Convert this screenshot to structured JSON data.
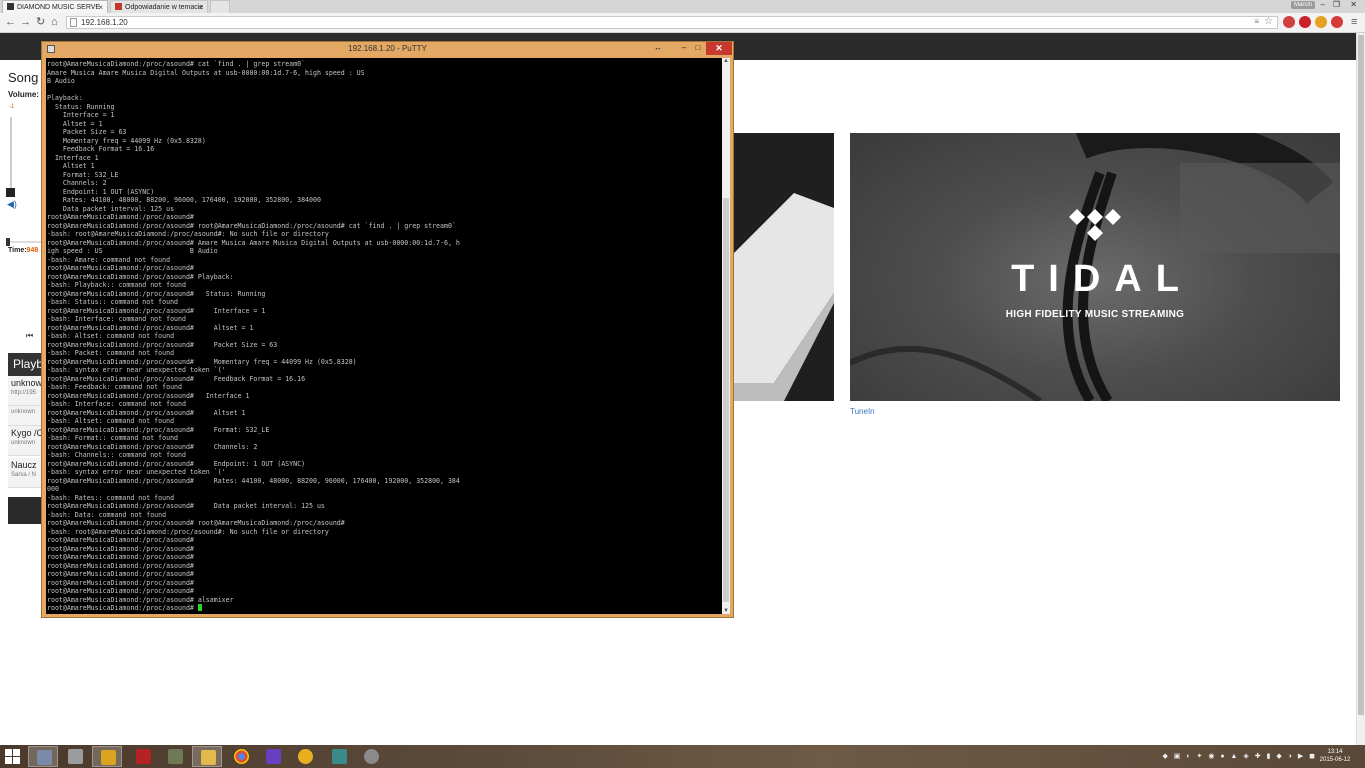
{
  "browser": {
    "tabs": [
      {
        "label": "DIAMOND MUSIC SERVE",
        "active": true
      },
      {
        "label": "Odpowiadanie w temacie",
        "active": false
      }
    ],
    "user_badge": "Marcin",
    "url": "192.168.1.20",
    "controls": {
      "minimize": "–",
      "maximize": "❐",
      "close": "✕"
    }
  },
  "page": {
    "song_title": "Song",
    "volume_label": "Volume:",
    "volume_value": "-1",
    "time_label": "Time:",
    "time_value": "948",
    "playlist_title": "Playback",
    "playlist": [
      {
        "title": "unknown",
        "subtitle": "http://195"
      },
      {
        "title": "",
        "subtitle": "unknown"
      },
      {
        "title": "Kygo /C",
        "subtitle": "unknown"
      },
      {
        "title": "Naucz",
        "subtitle": "Sarsa / N"
      }
    ],
    "tidal_title": "TIDAL",
    "tidal_subtitle": "HIGH FIDELITY MUSIC STREAMING",
    "tunein_label": "TuneIn"
  },
  "putty": {
    "title": "192.168.1.20 - PuTTY",
    "lines": [
      "root@AmareMusicaDiamond:/proc/asound# cat `find . | grep stream0`",
      "Amare Musica Amare Musica Digital Outputs at usb-0000:00:1d.7-6, high speed : US",
      "B Audio",
      "",
      "Playback:",
      "  Status: Running",
      "    Interface = 1",
      "    Altset = 1",
      "    Packet Size = 63",
      "    Momentary freq = 44099 Hz (0x5.8328)",
      "    Feedback Format = 16.16",
      "  Interface 1",
      "    Altset 1",
      "    Format: S32_LE",
      "    Channels: 2",
      "    Endpoint: 1 OUT (ASYNC)",
      "    Rates: 44100, 48000, 88200, 96000, 176400, 192000, 352800, 384000",
      "    Data packet interval: 125 us",
      "root@AmareMusicaDiamond:/proc/asound#",
      "root@AmareMusicaDiamond:/proc/asound# root@AmareMusicaDiamond:/proc/asound# cat `find . | grep stream0`",
      "-bash: root@AmareMusicaDiamond:/proc/asound#: No such file or directory",
      "root@AmareMusicaDiamond:/proc/asound# Amare Musica Amare Musica Digital Outputs at usb-0000:00:1d.7-6, h",
      "igh speed : US                      B Audio",
      "-bash: Amare: command not found",
      "root@AmareMusicaDiamond:/proc/asound#",
      "root@AmareMusicaDiamond:/proc/asound# Playback:",
      "-bash: Playback:: command not found",
      "root@AmareMusicaDiamond:/proc/asound#   Status: Running",
      "-bash: Status:: command not found",
      "root@AmareMusicaDiamond:/proc/asound#     Interface = 1",
      "-bash: Interface: command not found",
      "root@AmareMusicaDiamond:/proc/asound#     Altset = 1",
      "-bash: Altset: command not found",
      "root@AmareMusicaDiamond:/proc/asound#     Packet Size = 63",
      "-bash: Packet: command not found",
      "root@AmareMusicaDiamond:/proc/asound#     Momentary freq = 44099 Hz (0x5.8328)",
      "-bash: syntax error near unexpected token `('",
      "root@AmareMusicaDiamond:/proc/asound#     Feedback Format = 16.16",
      "-bash: Feedback: command not found",
      "root@AmareMusicaDiamond:/proc/asound#   Interface 1",
      "-bash: Interface: command not found",
      "root@AmareMusicaDiamond:/proc/asound#     Altset 1",
      "-bash: Altset: command not found",
      "root@AmareMusicaDiamond:/proc/asound#     Format: S32_LE",
      "-bash: Format:: command not found",
      "root@AmareMusicaDiamond:/proc/asound#     Channels: 2",
      "-bash: Channels:: command not found",
      "root@AmareMusicaDiamond:/proc/asound#     Endpoint: 1 OUT (ASYNC)",
      "-bash: syntax error near unexpected token `('",
      "root@AmareMusicaDiamond:/proc/asound#     Rates: 44100, 48000, 88200, 96000, 176400, 192000, 352800, 384",
      "000",
      "-bash: Rates:: command not found",
      "root@AmareMusicaDiamond:/proc/asound#     Data packet interval: 125 us",
      "-bash: Data: command not found",
      "root@AmareMusicaDiamond:/proc/asound# root@AmareMusicaDiamond:/proc/asound#",
      "-bash: root@AmareMusicaDiamond:/proc/asound#: No such file or directory",
      "root@AmareMusicaDiamond:/proc/asound#",
      "root@AmareMusicaDiamond:/proc/asound#",
      "root@AmareMusicaDiamond:/proc/asound#",
      "root@AmareMusicaDiamond:/proc/asound#",
      "root@AmareMusicaDiamond:/proc/asound#",
      "root@AmareMusicaDiamond:/proc/asound#",
      "root@AmareMusicaDiamond:/proc/asound#",
      "root@AmareMusicaDiamond:/proc/asound# alsamixer",
      "root@AmareMusicaDiamond:/proc/asound# "
    ]
  },
  "taskbar": {
    "clock_time": "13:14",
    "clock_date": "2015-06-12",
    "colors": {
      "start": "#ffffff",
      "putty_close": "#c7392e",
      "cursor": "#2bd62b",
      "time_value": "#e06000"
    }
  }
}
